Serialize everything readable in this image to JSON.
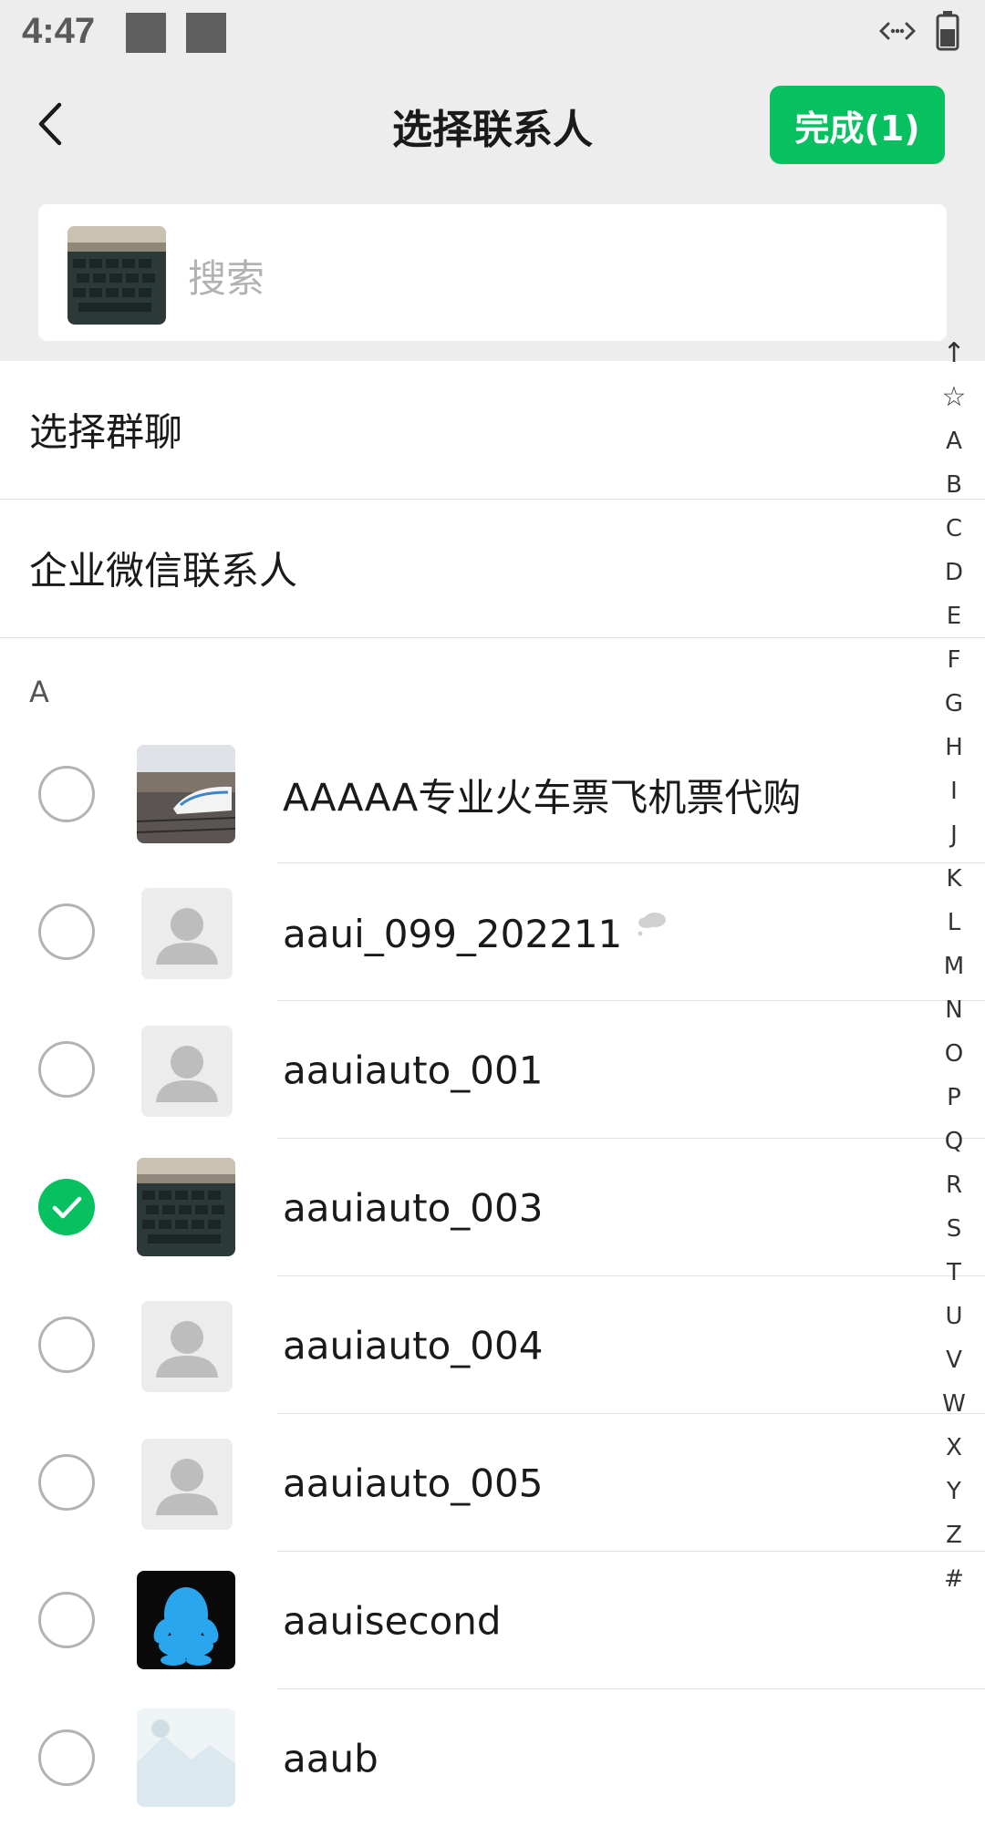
{
  "status": {
    "time": "4:47",
    "net_icon": "data-arrows-icon",
    "battery_icon": "battery-icon"
  },
  "header": {
    "title": "选择联系人",
    "done_label": "完成(1)",
    "back_icon": "back-chevron-icon"
  },
  "search": {
    "placeholder": "搜索"
  },
  "menu": {
    "group_chat": "选择群聊",
    "wecom_contacts": "企业微信联系人"
  },
  "section": {
    "letter": "A"
  },
  "contacts": [
    {
      "name": "AAAAA专业火车票飞机票代购",
      "checked": false,
      "avatar": "train-photo"
    },
    {
      "name": "aaui_099_202211",
      "checked": false,
      "avatar": "default-person",
      "badge": "cloud-icon"
    },
    {
      "name": "aauiauto_001",
      "checked": false,
      "avatar": "default-person"
    },
    {
      "name": "aauiauto_003",
      "checked": true,
      "avatar": "keyboard-photo"
    },
    {
      "name": "aauiauto_004",
      "checked": false,
      "avatar": "default-person"
    },
    {
      "name": "aauiauto_005",
      "checked": false,
      "avatar": "default-person"
    },
    {
      "name": "aauisecond",
      "checked": false,
      "avatar": "penguin-logo"
    },
    {
      "name": "aaub",
      "checked": false,
      "avatar": "light-photo"
    }
  ],
  "index_bar": [
    "↑",
    "☆",
    "A",
    "B",
    "C",
    "D",
    "E",
    "F",
    "G",
    "H",
    "I",
    "J",
    "K",
    "L",
    "M",
    "N",
    "O",
    "P",
    "Q",
    "R",
    "S",
    "T",
    "U",
    "V",
    "W",
    "X",
    "Y",
    "Z",
    "#"
  ],
  "colors": {
    "accent": "#07c160",
    "header_bg": "#ededed",
    "placeholder_text": "#b2b2b2"
  }
}
